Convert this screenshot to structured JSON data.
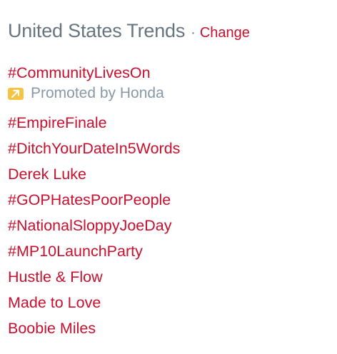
{
  "header": {
    "title": "United States Trends",
    "separator": "·",
    "change_label": "Change"
  },
  "promoted_trend": {
    "label": "#CommunityLivesOn",
    "promoted_text": "Promoted by Honda",
    "icon": "promoted-arrow-icon"
  },
  "trends": [
    "#EmpireFinale",
    "#DitchYourDateIn5Words",
    "Derek Luke",
    "#GOPHatesPoorPeople",
    "#NationalSloppyJoeDay",
    "#MP10LaunchParty",
    "Hustle & Flow",
    "Made to Love",
    "Boobie Miles"
  ],
  "colors": {
    "link": "#c8102e",
    "muted": "#66757f",
    "promoted_text": "#8899a6",
    "promoted_badge": "#f6c342"
  }
}
